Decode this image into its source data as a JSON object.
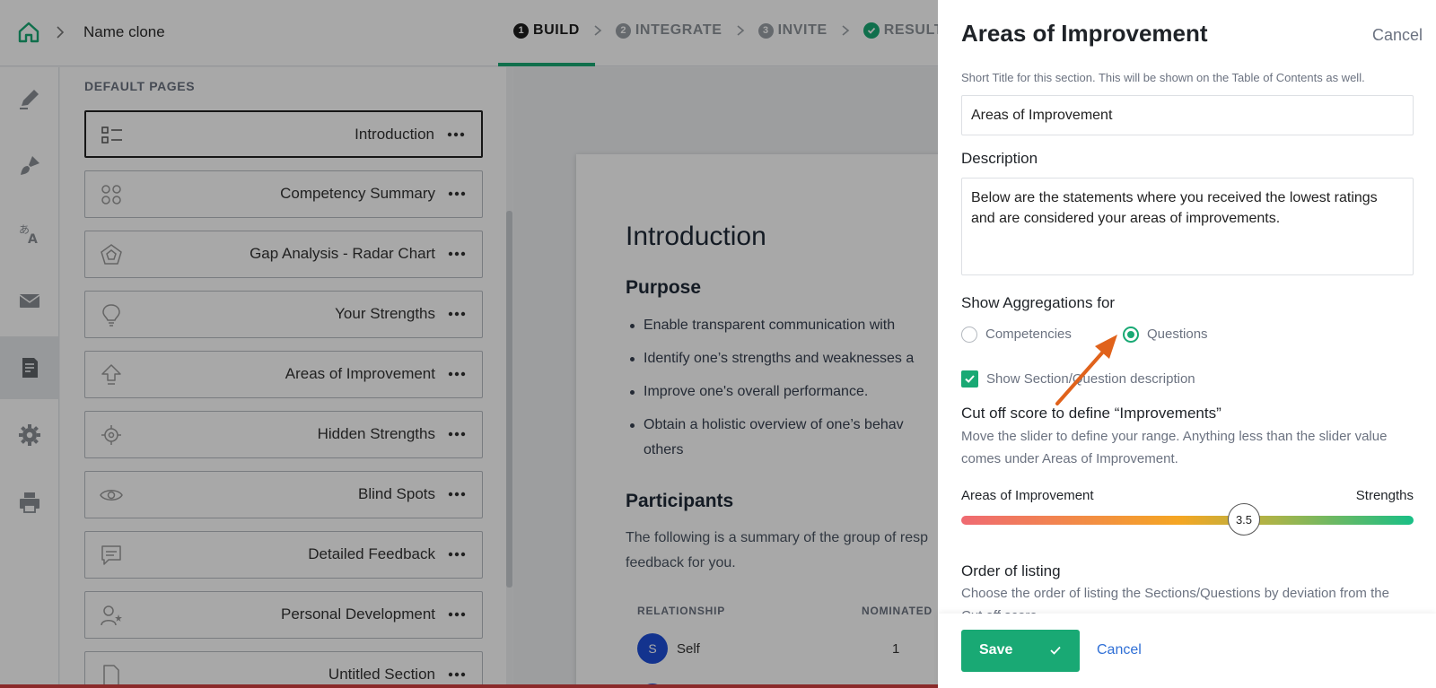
{
  "header": {
    "title": "Name clone",
    "steps": [
      {
        "num": "1",
        "label": "BUILD"
      },
      {
        "num": "2",
        "label": "INTEGRATE"
      },
      {
        "num": "3",
        "label": "INVITE"
      },
      {
        "label": "RESULTS"
      }
    ]
  },
  "rail": {
    "icons": [
      "pen-icon",
      "brush-icon",
      "translate-icon",
      "mail-icon",
      "report-icon",
      "gear-icon",
      "printer-icon"
    ]
  },
  "pages": {
    "heading": "DEFAULT PAGES",
    "items": [
      {
        "label": "Introduction",
        "icon": "list-icon"
      },
      {
        "label": "Competency Summary",
        "icon": "grid-icon"
      },
      {
        "label": "Gap Analysis - Radar Chart",
        "icon": "radar-icon"
      },
      {
        "label": "Your Strengths",
        "icon": "bulb-icon"
      },
      {
        "label": "Areas of Improvement",
        "icon": "arrow-up-icon"
      },
      {
        "label": "Hidden Strengths",
        "icon": "cog-icon"
      },
      {
        "label": "Blind Spots",
        "icon": "eye-icon"
      },
      {
        "label": "Detailed Feedback",
        "icon": "comment-icon"
      },
      {
        "label": "Personal Development",
        "icon": "person-star-icon"
      },
      {
        "label": "Untitled Section",
        "icon": "document-icon"
      }
    ]
  },
  "preview": {
    "title": "Introduction",
    "purpose_heading": "Purpose",
    "bullets": [
      "Enable transparent communication with",
      "Identify one’s strengths and weaknesses a",
      "Improve one's overall performance.",
      "Obtain a holistic overview of one’s behav"
    ],
    "bullet_cont": "others",
    "participants_heading": "Participants",
    "participants_text_1": "The following is a summary of the group of resp",
    "participants_text_2": "feedback for you.",
    "col_relationship": "RELATIONSHIP",
    "col_nominated": "NOMINATED",
    "row_avatar": "S",
    "row_name": "Self",
    "row_nominated": "1"
  },
  "drawer": {
    "title": "Areas of Improvement",
    "cancel_top": "Cancel",
    "short_title_hint": "Short Title for this section. This will be shown on the Table of Contents as well.",
    "short_title_value": "Areas of Improvement",
    "description_label": "Description",
    "description_value": "Below are the statements where you received the lowest ratings and are considered your areas of improvements.",
    "aggregation_label": "Show Aggregations for",
    "option_competencies": "Competencies",
    "option_questions": "Questions",
    "selected_option": "Questions",
    "show_description_label": "Show Section/Question description",
    "show_description_checked": true,
    "cutoff_heading": "Cut off score to define “Improvements”",
    "cutoff_desc": "Move the slider to define your range. Anything less than the slider value comes under Areas of Improvement.",
    "slider_left": "Areas of Improvement",
    "slider_right": "Strengths",
    "slider_value": "3.5",
    "slider_fraction": 0.625,
    "order_heading": "Order of listing",
    "order_desc": "Choose the order of listing the Sections/Questions by deviation from the Cut off score.",
    "save_label": "Save",
    "cancel_label": "Cancel"
  },
  "colors": {
    "accent": "#19a974",
    "link": "#2f6fd6",
    "annotation_arrow": "#e0621b"
  }
}
